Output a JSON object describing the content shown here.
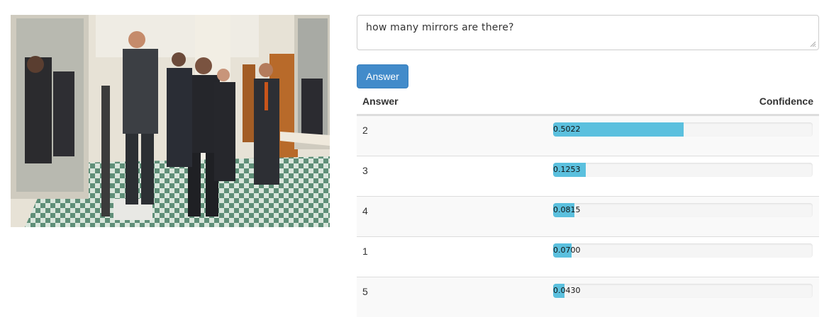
{
  "question": {
    "text": "how many mirrors are there?"
  },
  "answer_button": {
    "label": "Answer"
  },
  "results": {
    "headers": {
      "answer": "Answer",
      "confidence": "Confidence"
    },
    "rows": [
      {
        "answer": "2",
        "confidence": "0.5022",
        "value": 0.5022
      },
      {
        "answer": "3",
        "confidence": "0.1253",
        "value": 0.1253
      },
      {
        "answer": "4",
        "confidence": "0.0815",
        "value": 0.0815
      },
      {
        "answer": "1",
        "confidence": "0.0700",
        "value": 0.07
      },
      {
        "answer": "5",
        "confidence": "0.0430",
        "value": 0.043
      }
    ]
  },
  "colors": {
    "button": "#428bca",
    "bar_fill": "#5bc0de",
    "bar_track": "#f5f5f5",
    "stripe": "#f9f9f9"
  }
}
